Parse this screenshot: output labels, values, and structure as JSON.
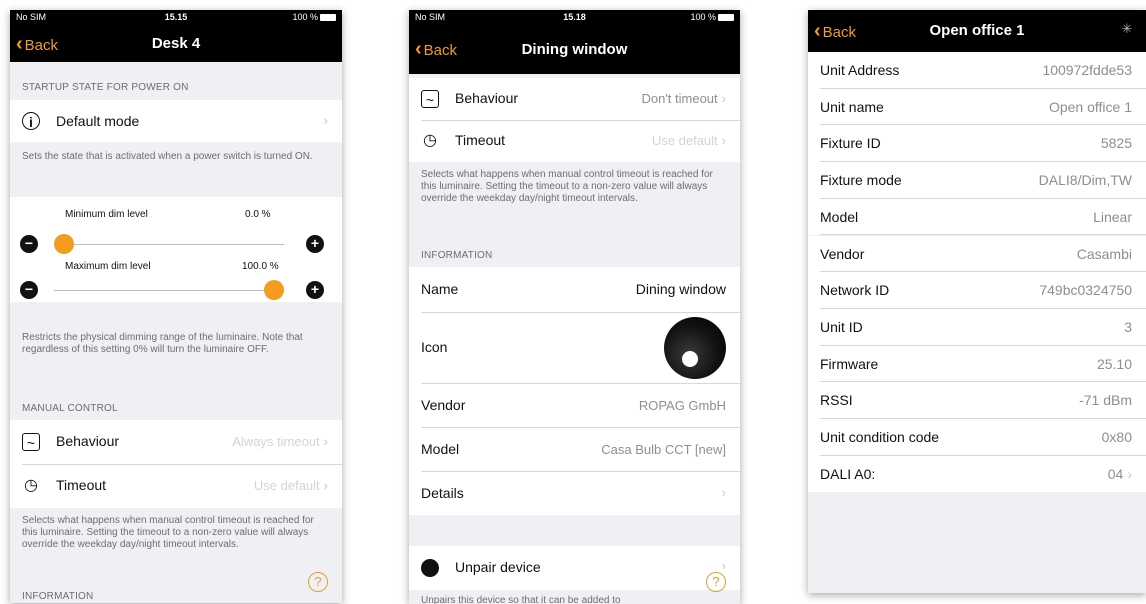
{
  "screen1": {
    "status": {
      "carrier": "No SIM",
      "time": "15.15",
      "battery": "100 %"
    },
    "nav": {
      "back": "Back",
      "title": "Desk 4"
    },
    "startup_header": "STARTUP STATE FOR POWER ON",
    "default_mode": "Default mode",
    "startup_note": "Sets the state that is activated when a power switch is turned ON.",
    "min_dim": {
      "label": "Minimum dim level",
      "value": "0.0 %",
      "level": 0.0
    },
    "max_dim": {
      "label": "Maximum dim level",
      "value": "100.0 %",
      "level": 1.0
    },
    "dim_note": "Restricts the physical dimming range of the luminaire. Note that regardless of this setting 0% will turn the luminaire OFF.",
    "manual_header": "MANUAL CONTROL",
    "behaviour": {
      "label": "Behaviour",
      "value": "Always timeout"
    },
    "timeout": {
      "label": "Timeout",
      "value": "Use default"
    },
    "timeout_note": "Selects what happens when manual control timeout is reached for this luminaire. Setting the timeout to a non-zero value will always override the weekday day/night timeout intervals.",
    "info_header": "INFORMATION",
    "help": "?"
  },
  "screen2": {
    "status": {
      "carrier": "No SIM",
      "time": "15.18",
      "battery": "100 %"
    },
    "nav": {
      "back": "Back",
      "title": "Dining window"
    },
    "behaviour": {
      "label": "Behaviour",
      "value": "Don't timeout"
    },
    "timeout": {
      "label": "Timeout",
      "value": "Use default"
    },
    "timeout_note": "Selects what happens when manual control timeout is reached for this luminaire. Setting the timeout to a non-zero value will always override the weekday day/night timeout intervals.",
    "info_header": "INFORMATION",
    "name": {
      "label": "Name",
      "value": "Dining window"
    },
    "icon_label": "Icon",
    "vendor": {
      "label": "Vendor",
      "value": "ROPAG GmbH"
    },
    "model": {
      "label": "Model",
      "value": "Casa Bulb CCT [new]"
    },
    "details": "Details",
    "unpair": "Unpair device",
    "unpair_note": "Unpairs this device so that it can be added to",
    "help": "?"
  },
  "screen3": {
    "nav": {
      "back": "Back",
      "title": "Open office 1"
    },
    "rows": [
      {
        "label": "Unit Address",
        "value": "100972fdde53"
      },
      {
        "label": "Unit name",
        "value": "Open office 1"
      },
      {
        "label": "Fixture ID",
        "value": "5825"
      },
      {
        "label": "Fixture mode",
        "value": "DALI8/Dim,TW"
      },
      {
        "label": "Model",
        "value": "Linear"
      },
      {
        "label": "Vendor",
        "value": "Casambi"
      },
      {
        "label": "Network ID",
        "value": "749bc0324750"
      },
      {
        "label": "Unit ID",
        "value": "3"
      },
      {
        "label": "Firmware",
        "value": "25.10"
      },
      {
        "label": "RSSI",
        "value": "-71 dBm"
      },
      {
        "label": "Unit condition code",
        "value": "0x80"
      },
      {
        "label": "DALI A0:",
        "value": "04"
      }
    ]
  },
  "icons": {
    "chevron": "›",
    "back_chevron": "‹",
    "info": "i",
    "wave": "~",
    "timer": "◷",
    "minus": "−",
    "plus": "+",
    "close": "×",
    "spinner": "✳"
  },
  "colors": {
    "accent": "#f39c1f",
    "bar": "#000000",
    "background": "#efeff4"
  }
}
